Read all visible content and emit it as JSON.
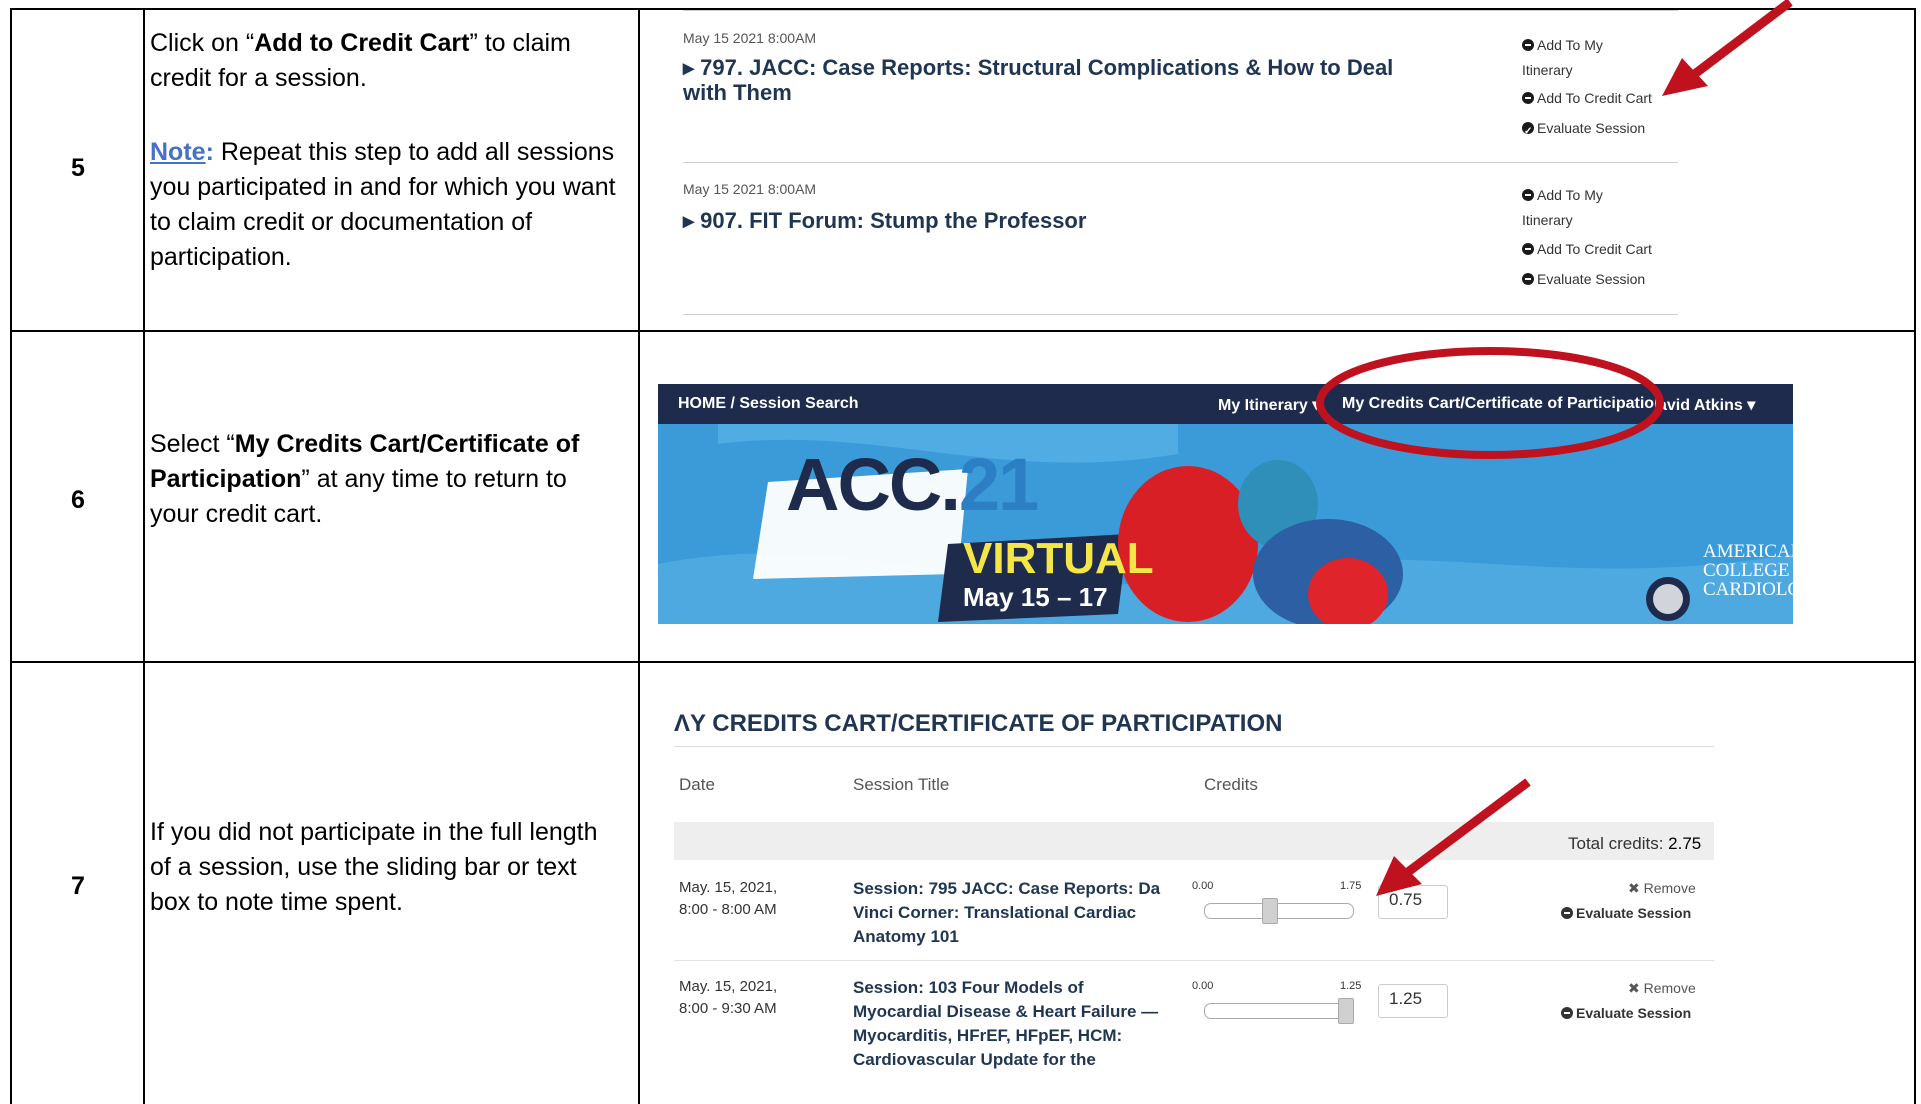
{
  "rows": [
    {
      "step": "5",
      "text_a": "Click on “",
      "text_b": "Add to Credit Cart",
      "text_c": "” to claim credit for a session.",
      "note_label": "Note",
      "note_colon": ":",
      "note_text": " Repeat this step to add all sessions you participated in and for which you want to claim credit or documentation of participation."
    },
    {
      "step": "6",
      "text_a": "Select “",
      "text_b": "My Credits Cart/Certificate of Participation",
      "text_c": "” at any time to return to your credit cart."
    },
    {
      "step": "7",
      "text": "If you did not participate in the full length of a session, use the sliding bar or text box to note time spent."
    }
  ],
  "sessions": [
    {
      "date": "May 15 2021 8:00AM",
      "title_line1": "▸ 797. JACC: Case Reports: Structural Complications & How to Deal",
      "title_line2": "with Them",
      "link1a": "Add To My",
      "link1b": "Itinerary",
      "link2": "Add To Credit Cart",
      "link3": "Evaluate Session"
    },
    {
      "date": "May 15 2021 8:00AM",
      "title_line1": "▸ 907. FIT Forum: Stump the Professor",
      "link1a": "Add To My",
      "link1b": "Itinerary",
      "link2": "Add To Credit Cart",
      "link3": "Evaluate Session"
    }
  ],
  "nav": {
    "home": "HOME / Session Search",
    "itinerary": "My Itinerary ▾",
    "credits": "My Credits Cart/Certificate of Participation",
    "user": "avid Atkins ▾"
  },
  "hero": {
    "acc": "ACC.",
    "acc21": "21",
    "virtual": "VIRTUAL",
    "dates": "May 15 – 17",
    "college1": "AMERICAN",
    "college2": "COLLEGE of",
    "college3": "CARDIOLOGY"
  },
  "cart": {
    "heading": "ΛY CREDITS CART/CERTIFICATE OF PARTICIPATION",
    "col_date": "Date",
    "col_title": "Session Title",
    "col_credits": "Credits",
    "total_label": "Total credits: ",
    "total_value": "2.75",
    "items": [
      {
        "date1": "May. 15, 2021,",
        "date2": "8:00 - 8:00 AM",
        "title": "Session: 795 JACC: Case Reports: Da Vinci Corner: Translational Cardiac Anatomy 101",
        "min": "0.00",
        "max": "1.75",
        "value": "0.75",
        "slider_fraction": 0.43,
        "remove": "✖ Remove",
        "evaluate": "Evaluate Session"
      },
      {
        "date1": "May. 15, 2021,",
        "date2": "8:00 - 9:30 AM",
        "title": "Session: 103 Four Models of Myocardial Disease & Heart Failure — Myocarditis, HFrEF, HFpEF, HCM: Cardiovascular Update for the",
        "min": "0.00",
        "max": "1.25",
        "value": "1.25",
        "slider_fraction": 1.0,
        "remove": "✖ Remove",
        "evaluate": "Evaluate Session"
      }
    ]
  },
  "colors": {
    "navy": "#1e2b4d",
    "accent_red": "#c0111f",
    "banner_blue": "#3a9bd8",
    "link_blue": "#4472c4"
  }
}
